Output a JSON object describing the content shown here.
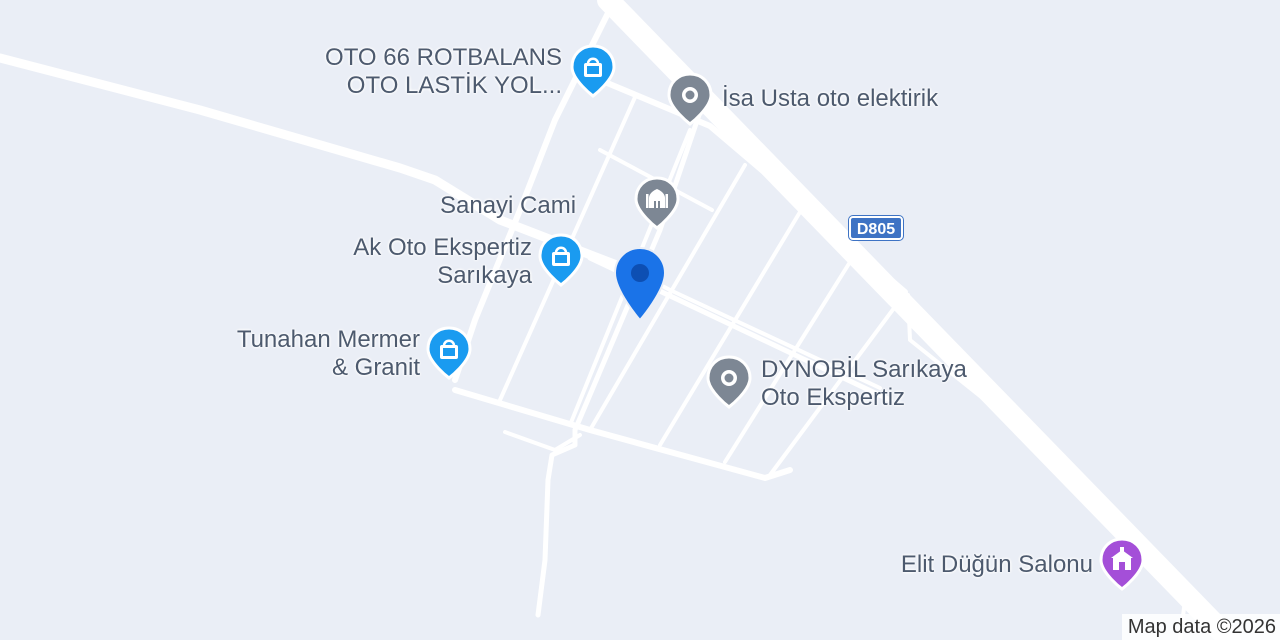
{
  "map": {
    "attribution": "Map data ©2026",
    "road_shield": "D805",
    "places": [
      {
        "id": "oto66",
        "lines": [
          "OTO 66 ROTBALANS",
          "OTO LASTİK YOL..."
        ],
        "icon": "shopping-bag-icon",
        "color": "#1a9bf0"
      },
      {
        "id": "isa",
        "lines": [
          "İsa Usta oto elektirik"
        ],
        "icon": "place-dot-icon",
        "color": "#7d8794"
      },
      {
        "id": "sanayi",
        "lines": [
          "Sanayi Cami"
        ],
        "icon": "mosque-icon",
        "color": "#7d8794"
      },
      {
        "id": "akoto",
        "lines": [
          "Ak Oto Ekspertiz",
          "Sarıkaya"
        ],
        "icon": "shopping-bag-icon",
        "color": "#1a9bf0"
      },
      {
        "id": "tunahan",
        "lines": [
          "Tunahan Mermer",
          "& Granit"
        ],
        "icon": "shopping-bag-icon",
        "color": "#1a9bf0"
      },
      {
        "id": "dynobil",
        "lines": [
          "DYNOBİL Sarıkaya",
          "Oto Ekspertiz"
        ],
        "icon": "place-dot-icon",
        "color": "#7d8794"
      },
      {
        "id": "elit",
        "lines": [
          "Elit Düğün Salonu"
        ],
        "icon": "wedding-hall-icon",
        "color": "#a44fd8"
      }
    ],
    "selected_pin_color": "#1a73e8",
    "highway_color": "#ffffff",
    "land_color": "#eaeef6"
  }
}
